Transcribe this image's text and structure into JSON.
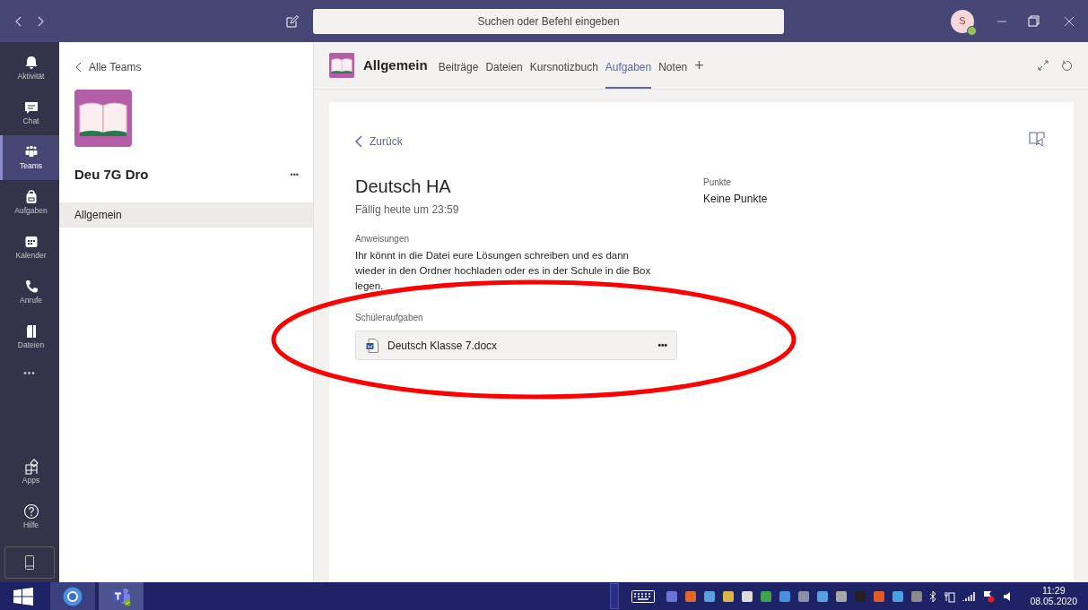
{
  "title_bar": {
    "search_placeholder": "Suchen oder Befehl eingeben",
    "avatar_initial": "S",
    "available": true
  },
  "rail": {
    "items": [
      {
        "label": "Aktivität",
        "kind": "bell",
        "selected": false
      },
      {
        "label": "Chat",
        "kind": "chat",
        "selected": false
      },
      {
        "label": "Teams",
        "kind": "teams",
        "selected": true
      },
      {
        "label": "Aufgaben",
        "kind": "bag",
        "selected": false
      },
      {
        "label": "Kalender",
        "kind": "calendar",
        "selected": false
      },
      {
        "label": "Anrufe",
        "kind": "phone",
        "selected": false
      },
      {
        "label": "Dateien",
        "kind": "file",
        "selected": false
      }
    ],
    "more": "•••",
    "bottom_items": [
      {
        "label": "Apps",
        "kind": "apps"
      },
      {
        "label": "Hilfe",
        "kind": "help"
      }
    ]
  },
  "team_panel": {
    "back": "Alle Teams",
    "team_name": "Deu 7G Dro",
    "more": "•••",
    "channels": [
      {
        "label": "Allgemein",
        "selected": true
      }
    ]
  },
  "channel_header": {
    "channel": "Allgemein",
    "tabs": [
      {
        "label": "Beiträge",
        "selected": false
      },
      {
        "label": "Dateien",
        "selected": false
      },
      {
        "label": "Kursnotizbuch",
        "selected": false
      },
      {
        "label": "Aufgaben",
        "selected": true
      },
      {
        "label": "Noten",
        "selected": false
      }
    ],
    "add": "+"
  },
  "assignment": {
    "back": "Zurück",
    "title": "Deutsch HA",
    "due": "Fällig heute um 23:59",
    "instructions_label": "Anweisungen",
    "instructions": "Ihr könnt in die Datei eure Lösungen schreiben und es dann wieder in den Ordner hochladen oder es in der Schule in die Box legen.",
    "points_label": "Punkte",
    "points": "Keine Punkte",
    "student_work_label": "Schüleraufgaben",
    "files": [
      {
        "name": "Deutsch Klasse 7.docx",
        "more": "•••"
      }
    ]
  },
  "taskbar": {
    "apps": [
      {
        "kind": "chrome"
      },
      {
        "kind": "teams"
      }
    ],
    "time": "11:29",
    "date": "08.05.2020"
  },
  "annotation": {
    "kind": "ellipse"
  }
}
